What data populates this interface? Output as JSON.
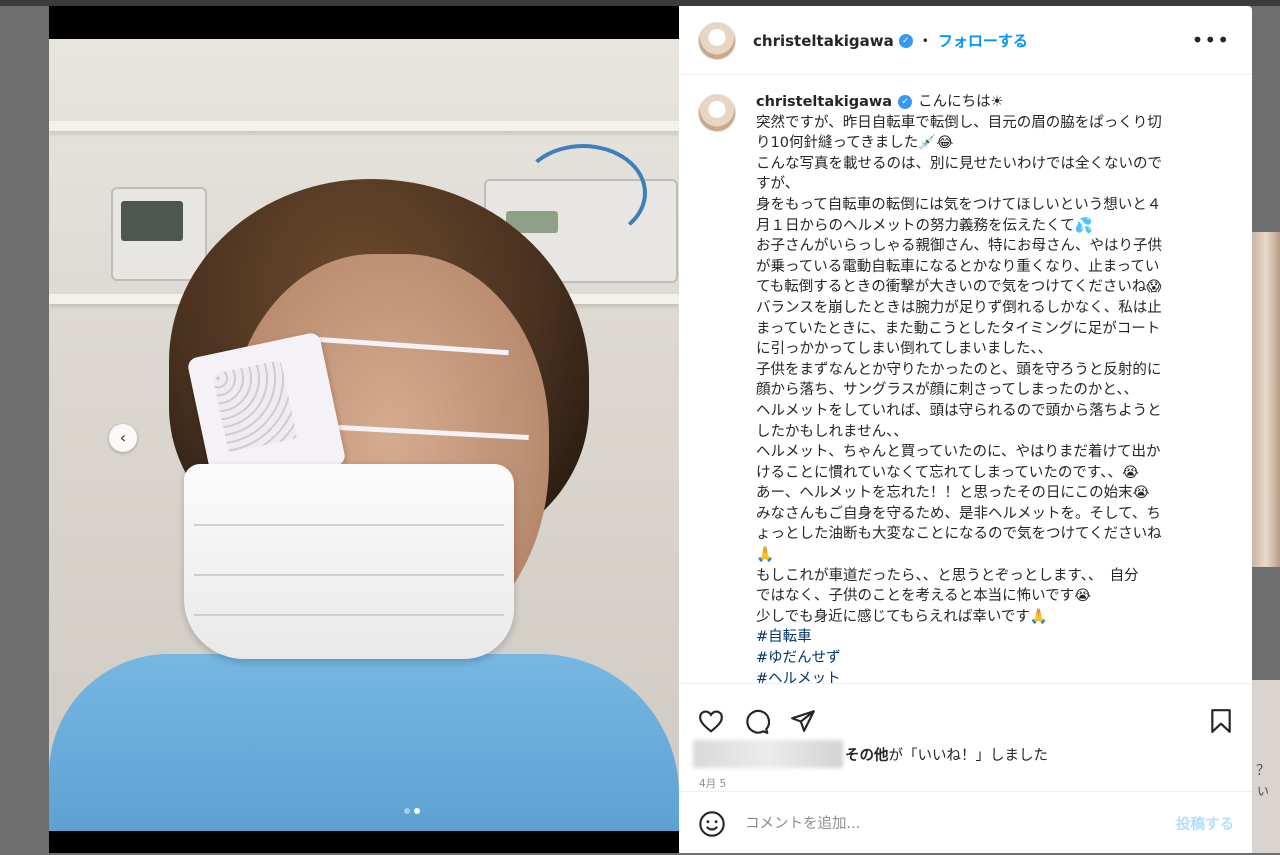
{
  "post": {
    "username": "christeltakigawa",
    "follow_label": "フォローする",
    "separator": "•",
    "more_label": "•••",
    "caption_lines": [
      "こんにちは☀",
      "突然ですが、昨日自転車で転倒し、目元の眉の脇をぱっくり切",
      "り10何針縫ってきました💉😂",
      "こんな写真を載せるのは、別に見せたいわけでは全くないので",
      "すが、",
      "身をもって自転車の転倒には気をつけてほしいという想いと４",
      "月１日からのヘルメットの努力義務を伝えたくて💦",
      "お子さんがいらっしゃる親御さん、特にお母さん、やはり子供",
      "が乗っている電動自転車になるとかなり重くなり、止まってい",
      "ても転倒するときの衝撃が大きいので気をつけてくださいね😱",
      "バランスを崩したときは腕力が足りず倒れるしかなく、私は止",
      "まっていたときに、また動こうとしたタイミングに足がコート",
      "に引っかかってしまい倒れてしまいました、、",
      "子供をまずなんとか守りたかったのと、頭を守ろうと反射的に",
      "顔から落ち、サングラスが顔に刺さってしまったのかと、、",
      "ヘルメットをしていれば、頭は守られるので頭から落ちようと",
      "したかもしれません、、",
      "ヘルメット、ちゃんと買っていたのに、やはりまだ着けて出か",
      "けることに慣れていなくて忘れてしまっていたのです、、😭",
      "あー、ヘルメットを忘れた！！と思ったその日にこの始末😭",
      "みなさんもご自身を守るため、是非ヘルメットを。そして、ち",
      "ょっとした油断も大変なことになるので気をつけてくださいね",
      "🙏",
      "もしこれが車道だったら、、と思うとぞっとします、、　自分",
      "ではなく、子供のことを考えると本当に怖いです😭",
      "少しでも身近に感じてもらえれば幸いです🙏"
    ],
    "hashtags": [
      "#自転車",
      "#ゆだんせず",
      "#ヘルメット"
    ],
    "likes_suffix_bold": "その他",
    "likes_suffix": "が「いいね！」しました",
    "date": "4月 5",
    "comment_placeholder": "コメントを追加...",
    "post_button": "投稿する",
    "carousel": {
      "count": 2,
      "active_index": 1
    },
    "icons": {
      "like": "heart-icon",
      "comment": "comment-icon",
      "share": "paper-plane-icon",
      "save": "bookmark-icon",
      "emoji": "smiley-icon",
      "prev": "chevron-left-icon"
    }
  },
  "background": {
    "partial_text": "？ ぃ"
  },
  "colors": {
    "link_blue": "#0095f6",
    "post_button_disabled": "#b2dffc",
    "text": "#262626",
    "secondary": "#8e8e8e"
  }
}
